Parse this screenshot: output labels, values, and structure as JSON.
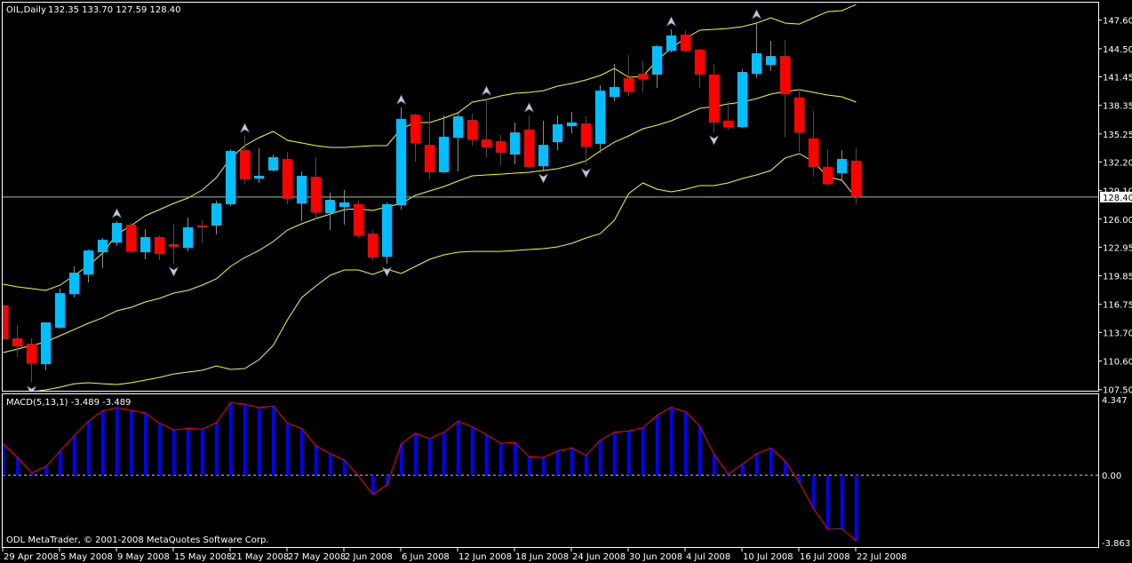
{
  "window": {
    "title_symbol": "OIL,Daily",
    "title_ohlc": "132.35 133.70 127.59 128.40",
    "copyright": "ODL MetaTrader, © 2001-2008 MetaQuotes Software Corp."
  },
  "colors": {
    "background": "#000000",
    "bull": "#00BFFF",
    "bear": "#FF0000",
    "bands": "#FFFF00",
    "macd_hist": "#0000FF",
    "macd_signal": "#FF0000",
    "price_line": "#8FCF8F",
    "fractal": "#C8C8D8",
    "axis": "#FFFFFF"
  },
  "price_axis": {
    "labels": [
      "147.60",
      "144.50",
      "141.45",
      "138.35",
      "135.25",
      "132.20",
      "129.10",
      "126.00",
      "122.95",
      "119.85",
      "116.75",
      "113.70",
      "110.60",
      "107.50"
    ],
    "current_price": "128.40"
  },
  "macd_panel": {
    "label": "MACD(5,13,1) -3.489 -3.489",
    "axis_labels": [
      "4.347",
      "0.00",
      "-3.863"
    ]
  },
  "time_axis": {
    "labels": [
      "29 Apr 2008",
      "5 May 2008",
      "9 May 2008",
      "15 May 2008",
      "21 May 2008",
      "27 May 2008",
      "2 Jun 2008",
      "6 Jun 2008",
      "12 Jun 2008",
      "18 Jun 2008",
      "24 Jun 2008",
      "30 Jun 2008",
      "4 Jul 2008",
      "10 Jul 2008",
      "16 Jul 2008",
      "22 Jul 2008"
    ]
  },
  "chart_data": [
    {
      "type": "candlestick",
      "title": "OIL,Daily",
      "ylim": [
        107.5,
        147.6
      ],
      "ohlc_order": [
        "open",
        "high",
        "low",
        "close"
      ],
      "candles": [
        [
          116.63,
          116.72,
          112.87,
          112.96
        ],
        [
          113.06,
          114.5,
          111.03,
          112.19
        ],
        [
          112.48,
          113.06,
          108.24,
          110.36
        ],
        [
          110.26,
          114.79,
          109.59,
          114.79
        ],
        [
          114.22,
          118.46,
          114.12,
          117.97
        ],
        [
          117.88,
          120.87,
          117.49,
          120.19
        ],
        [
          120.0,
          122.7,
          119.13,
          122.6
        ],
        [
          122.41,
          123.95,
          120.7,
          123.76
        ],
        [
          123.47,
          125.78,
          123.09,
          125.59
        ],
        [
          125.4,
          125.6,
          122.31,
          122.5
        ],
        [
          122.41,
          124.92,
          121.64,
          124.05
        ],
        [
          124.05,
          124.24,
          121.54,
          122.22
        ],
        [
          123.28,
          125.49,
          121.16,
          122.99
        ],
        [
          122.89,
          126.17,
          122.5,
          125.11
        ],
        [
          125.3,
          125.88,
          123.47,
          125.11
        ],
        [
          125.3,
          128.0,
          124.34,
          127.71
        ],
        [
          127.62,
          133.6,
          127.4,
          133.4
        ],
        [
          133.5,
          135.04,
          129.83,
          130.32
        ],
        [
          130.41,
          133.69,
          129.93,
          130.7
        ],
        [
          131.28,
          133.01,
          131.18,
          132.73
        ],
        [
          132.53,
          133.3,
          127.62,
          128.2
        ],
        [
          127.71,
          131.18,
          125.78,
          130.7
        ],
        [
          130.6,
          132.73,
          125.98,
          126.75
        ],
        [
          126.65,
          128.87,
          124.82,
          128.1
        ],
        [
          127.33,
          129.16,
          125.4,
          127.81
        ],
        [
          127.62,
          128.0,
          123.95,
          124.24
        ],
        [
          124.43,
          124.82,
          121.54,
          121.83
        ],
        [
          121.93,
          127.81,
          121.16,
          127.62
        ],
        [
          127.52,
          138.12,
          127.04,
          136.87
        ],
        [
          137.35,
          137.45,
          132.24,
          134.27
        ],
        [
          134.07,
          137.64,
          130.32,
          131.09
        ],
        [
          131.09,
          137.26,
          130.99,
          134.94
        ],
        [
          134.85,
          137.45,
          131.18,
          137.16
        ],
        [
          136.77,
          137.45,
          133.98,
          134.65
        ],
        [
          134.65,
          139.09,
          132.73,
          133.79
        ],
        [
          134.46,
          135.14,
          131.86,
          133.21
        ],
        [
          133.01,
          136.49,
          131.95,
          135.42
        ],
        [
          135.71,
          137.26,
          131.47,
          131.66
        ],
        [
          131.76,
          136.68,
          131.28,
          134.07
        ],
        [
          134.36,
          137.26,
          133.5,
          136.29
        ],
        [
          136.1,
          137.64,
          135.33,
          136.49
        ],
        [
          136.39,
          137.16,
          131.86,
          133.88
        ],
        [
          134.17,
          140.53,
          133.21,
          139.95
        ],
        [
          139.28,
          142.85,
          138.8,
          140.34
        ],
        [
          141.3,
          143.81,
          139.38,
          139.86
        ],
        [
          141.79,
          143.23,
          139.76,
          141.21
        ],
        [
          141.69,
          144.87,
          140.24,
          144.77
        ],
        [
          144.29,
          146.61,
          144.1,
          145.93
        ],
        [
          146.03,
          146.51,
          144.1,
          144.29
        ],
        [
          144.39,
          144.49,
          140.24,
          141.69
        ],
        [
          141.69,
          142.85,
          135.43,
          136.49
        ],
        [
          136.68,
          138.8,
          135.71,
          136.0
        ],
        [
          136.0,
          142.27,
          135.9,
          141.98
        ],
        [
          141.79,
          147.38,
          141.3,
          144.0
        ],
        [
          142.75,
          145.35,
          142.08,
          143.71
        ],
        [
          143.71,
          145.45,
          134.85,
          139.57
        ],
        [
          139.19,
          140.05,
          133.3,
          135.42
        ],
        [
          134.75,
          137.74,
          130.6,
          131.66
        ],
        [
          131.66,
          133.59,
          129.64,
          129.83
        ],
        [
          131.0,
          133.5,
          130.22,
          132.53
        ],
        [
          132.35,
          133.7,
          127.59,
          128.4
        ]
      ],
      "bollinger_upper": [
        118.94,
        118.65,
        118.46,
        118.27,
        118.84,
        119.9,
        120.96,
        122.31,
        124.34,
        125.3,
        126.36,
        127.04,
        127.71,
        128.29,
        129.16,
        130.51,
        132.63,
        133.98,
        134.85,
        135.52,
        134.56,
        134.27,
        133.98,
        133.79,
        133.79,
        133.88,
        133.98,
        133.98,
        135.81,
        136.49,
        136.49,
        136.97,
        137.55,
        138.7,
        138.99,
        139.38,
        139.67,
        139.76,
        139.95,
        140.44,
        140.73,
        141.11,
        141.59,
        142.36,
        141.4,
        141.5,
        143.23,
        144.58,
        145.64,
        146.51,
        146.6,
        146.7,
        146.9,
        147.28,
        147.86,
        147.28,
        147.18,
        147.86,
        148.53,
        148.63,
        149.3
      ],
      "bollinger_middle": [
        111.52,
        111.9,
        112.29,
        112.67,
        113.35,
        114.02,
        114.7,
        115.3,
        116.05,
        116.43,
        117.01,
        117.4,
        117.98,
        118.27,
        118.84,
        119.52,
        120.87,
        121.83,
        122.6,
        123.57,
        124.82,
        125.5,
        126.07,
        126.55,
        127.04,
        127.13,
        126.94,
        127.33,
        127.71,
        128.58,
        129.06,
        129.54,
        130.13,
        130.7,
        130.8,
        130.89,
        130.99,
        131.09,
        131.28,
        131.47,
        131.86,
        132.34,
        133.4,
        134.36,
        135.04,
        135.81,
        136.2,
        136.68,
        137.35,
        138.03,
        138.22,
        138.51,
        138.7,
        139.09,
        139.57,
        139.86,
        140.05,
        139.76,
        139.47,
        139.28,
        138.7
      ],
      "bollinger_lower": [
        106.89,
        107.08,
        107.27,
        107.47,
        107.76,
        108.14,
        108.24,
        108.14,
        108.05,
        108.24,
        108.53,
        108.82,
        109.2,
        109.4,
        109.59,
        110.07,
        109.69,
        109.78,
        110.75,
        112.29,
        115.08,
        117.49,
        118.75,
        119.9,
        120.48,
        120.48,
        120.0,
        120.58,
        120.1,
        120.87,
        121.64,
        122.12,
        122.41,
        122.5,
        122.5,
        122.5,
        122.6,
        122.7,
        122.8,
        122.99,
        123.38,
        123.95,
        124.43,
        125.88,
        128.77,
        129.93,
        129.25,
        128.97,
        129.25,
        129.64,
        129.64,
        129.93,
        130.41,
        130.8,
        131.28,
        132.63,
        133.11,
        132.24,
        130.6,
        130.22,
        128.29
      ],
      "fractals_up_bars": [
        8,
        17,
        28,
        34,
        37,
        47,
        53
      ],
      "fractals_down_bars": [
        2,
        12,
        27,
        38,
        41,
        50
      ],
      "current_price_line": 128.4,
      "grid": false
    },
    {
      "type": "bar",
      "title": "MACD(5,13,1)",
      "ylim": [
        -3.863,
        4.347
      ],
      "histogram": [
        1.66,
        0.95,
        0.12,
        0.47,
        1.27,
        2.1,
        2.88,
        3.42,
        3.59,
        3.44,
        3.31,
        2.76,
        2.41,
        2.49,
        2.45,
        2.79,
        3.86,
        3.78,
        3.59,
        3.67,
        2.76,
        2.49,
        1.56,
        1.15,
        0.8,
        -0.05,
        -1.02,
        -0.51,
        1.66,
        2.24,
        1.94,
        2.29,
        2.87,
        2.57,
        2.16,
        1.69,
        1.74,
        0.98,
        0.94,
        1.29,
        1.45,
        1.06,
        1.85,
        2.29,
        2.35,
        2.52,
        3.18,
        3.61,
        3.37,
        2.6,
        1.11,
        0.06,
        0.59,
        1.15,
        1.45,
        0.75,
        -0.38,
        -1.77,
        -2.87,
        -2.84,
        -3.489
      ],
      "zero_line": 0
    }
  ]
}
